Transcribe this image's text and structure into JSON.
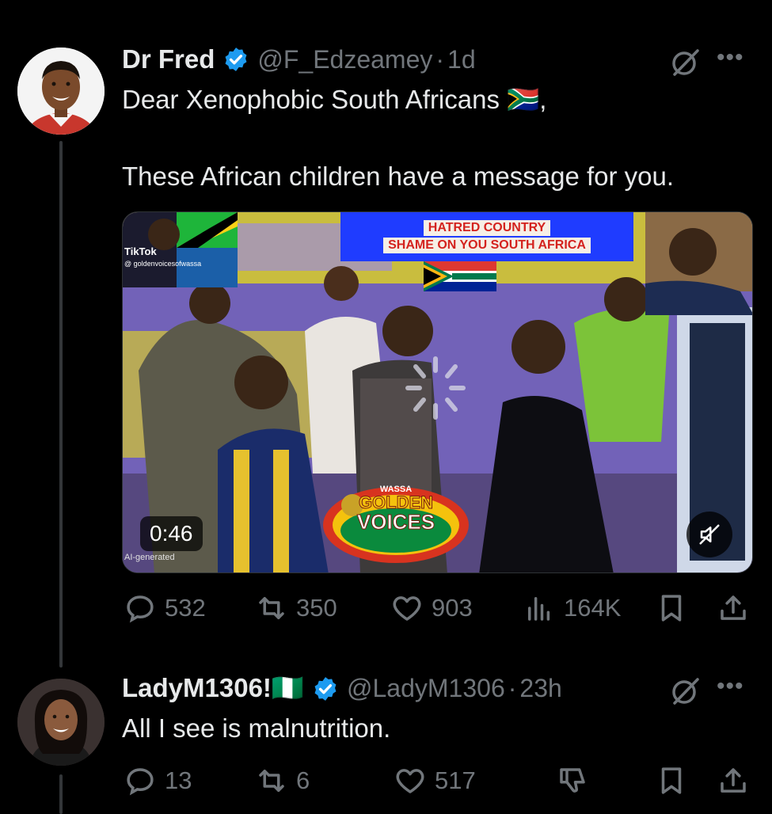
{
  "tweets": [
    {
      "name": "Dr Fred",
      "handle": "@F_Edzeamey",
      "sep": "·",
      "time": "1d",
      "text_line1": "Dear Xenophobic South Africans 🇿🇦,",
      "text_line2": "These African children have a message for you.",
      "media": {
        "banner_line1": "HATRED COUNTRY",
        "banner_line2": "SHAME ON YOU SOUTH AFRICA",
        "tiktok_label": "TikTok",
        "tiktok_handle": "@ goldenvoicesofwassa",
        "logo_top": "WASSA",
        "logo_line1": "GOLDEN",
        "logo_line2": "VOICES",
        "duration": "0:46",
        "ai_label": "AI-generated"
      },
      "stats": {
        "replies": "532",
        "reposts": "350",
        "likes": "903",
        "views": "164K"
      }
    },
    {
      "name": "LadyM1306!🇳🇬",
      "handle": "@LadyM1306",
      "sep": "·",
      "time": "23h",
      "text_line1": "All I see is malnutrition.",
      "stats": {
        "replies": "13",
        "reposts": "6",
        "likes": "517"
      }
    }
  ],
  "colors": {
    "background": "#000000",
    "text": "#e7e9ea",
    "muted": "#71767b",
    "verified": "#1d9bf0"
  },
  "icons": [
    "grok-icon",
    "more-icon",
    "reply-icon",
    "repost-icon",
    "like-icon",
    "views-icon",
    "bookmark-icon",
    "share-icon",
    "mute-icon",
    "downvote-icon"
  ]
}
